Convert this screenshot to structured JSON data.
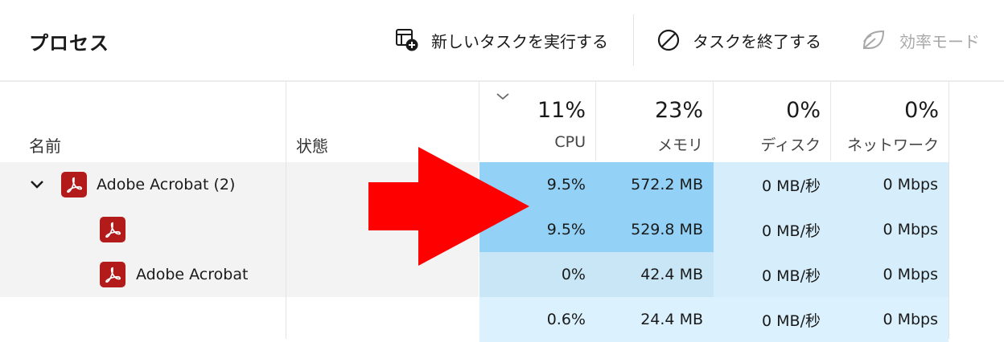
{
  "toolbar": {
    "title": "プロセス",
    "run_new_task": "新しいタスクを実行する",
    "end_task": "タスクを終了する",
    "efficiency_mode": "効率モード"
  },
  "header": {
    "name": "名前",
    "status": "状態",
    "cpu": {
      "percent": "11%",
      "label": "CPU"
    },
    "memory": {
      "percent": "23%",
      "label": "メモリ"
    },
    "disk": {
      "percent": "0%",
      "label": "ディスク"
    },
    "network": {
      "percent": "0%",
      "label": "ネットワーク"
    }
  },
  "rows": [
    {
      "name": "Adobe Acrobat (2)",
      "cpu": "9.5%",
      "memory": "572.2 MB",
      "disk": "0 MB/秒",
      "network": "0 Mbps"
    },
    {
      "name": "",
      "cpu": "9.5%",
      "memory": "529.8 MB",
      "disk": "0 MB/秒",
      "network": "0 Mbps"
    },
    {
      "name": "Adobe Acrobat",
      "cpu": "0%",
      "memory": "42.4 MB",
      "disk": "0 MB/秒",
      "network": "0 Mbps"
    },
    {
      "name": "",
      "cpu": "0.6%",
      "memory": "24.4 MB",
      "disk": "0 MB/秒",
      "network": "0 Mbps"
    }
  ],
  "colors": {
    "heat_dark": "#93d2f6",
    "heat_mid": "#c9e6f6",
    "heat_light": "#d6eefb",
    "annotation_arrow": "#ff0000",
    "acrobat_red": "#b31b1b"
  },
  "icons": [
    "run-task-icon",
    "end-task-icon",
    "efficiency-leaf-icon",
    "sort-chevron-icon",
    "expand-chevron-icon",
    "acrobat-icon",
    "red-arrow-annotation"
  ]
}
